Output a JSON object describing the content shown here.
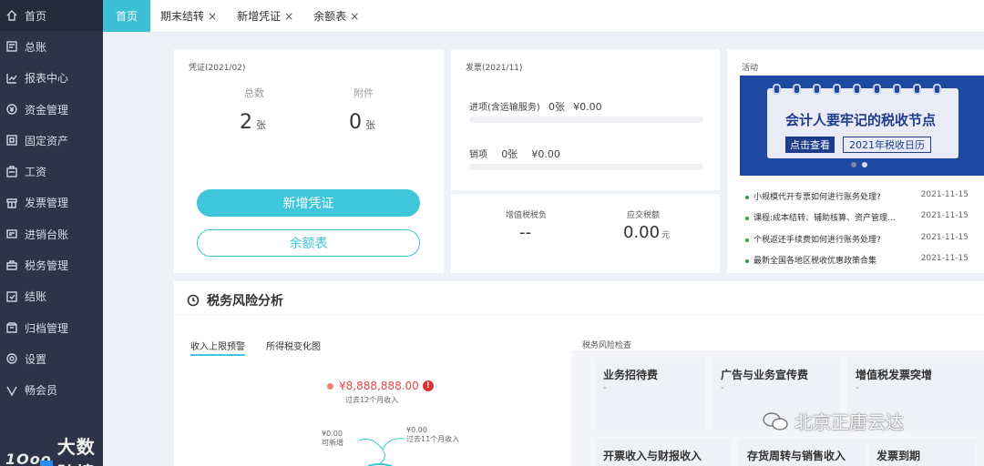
{
  "sidebar": {
    "items": [
      {
        "label": "首页",
        "icon": "home-icon"
      },
      {
        "label": "总账",
        "icon": "ledger-icon"
      },
      {
        "label": "报表中心",
        "icon": "chart-icon"
      },
      {
        "label": "资金管理",
        "icon": "money-icon"
      },
      {
        "label": "固定资产",
        "icon": "asset-icon"
      },
      {
        "label": "工资",
        "icon": "salary-icon"
      },
      {
        "label": "发票管理",
        "icon": "invoice-icon"
      },
      {
        "label": "进销台账",
        "icon": "inventory-icon"
      },
      {
        "label": "税务管理",
        "icon": "tax-icon"
      },
      {
        "label": "结账",
        "icon": "closing-icon"
      },
      {
        "label": "归档管理",
        "icon": "archive-icon"
      },
      {
        "label": "设置",
        "icon": "gear-icon"
      },
      {
        "label": "畅会员",
        "icon": "vip-icon"
      }
    ],
    "logo_text": "大数跨境",
    "logo_mark": "1Ooo"
  },
  "tabs": [
    {
      "label": "首页",
      "closable": false
    },
    {
      "label": "期末结转",
      "closable": true
    },
    {
      "label": "新增凭证",
      "closable": true
    },
    {
      "label": "余额表",
      "closable": true
    }
  ],
  "close_glyph": "×",
  "voucher": {
    "title": "凭证(2021/02)",
    "total_label": "总数",
    "total_value": "2",
    "attach_label": "附件",
    "attach_value": "0",
    "unit": "张",
    "new_button": "新增凭证",
    "balance_button": "余额表"
  },
  "invoice": {
    "title": "发票(2021/11)",
    "input_label": "进项(含运输服务)",
    "input_count": "0张",
    "input_amount": "¥0.00",
    "output_label": "销项",
    "output_count": "0张",
    "output_amount": "¥0.00"
  },
  "tax": {
    "burden_label": "增值税税负",
    "burden_value": "--",
    "payable_label": "应交税额",
    "payable_value": "0.00",
    "payable_unit": "元"
  },
  "activity": {
    "title": "活动",
    "banner_title": "会计人要牢记的税收节点",
    "banner_btn1": "点击查看",
    "banner_btn2": "2021年税收日历",
    "news": [
      {
        "text": "小规模代开专票如何进行账务处理?",
        "date": "2021-11-15"
      },
      {
        "text": "课程:成本结转、辅助核算、资产管理...",
        "date": "2021-11-15"
      },
      {
        "text": "个税返还手续费如何进行账务处理?",
        "date": "2021-11-15"
      },
      {
        "text": "最新全国各地区税收优惠政策合集",
        "date": "2021-11-15"
      }
    ]
  },
  "risk": {
    "title": "税务风险分析",
    "subtabs": [
      "收入上限预警",
      "所得税变化图"
    ],
    "limit_value": "¥8,888,888.00",
    "limit_warn": "!",
    "limit_note": "过去12个月收入",
    "left_note_amount": "¥0.00",
    "left_note_label": "可新增",
    "right_note_amount": "¥0.00",
    "right_note_label": "过去11个月收入",
    "check_title": "税务风险检查",
    "checks": [
      {
        "title": "业务招待费",
        "value": "-"
      },
      {
        "title": "广告与业务宣传费",
        "value": "-"
      },
      {
        "title": "增值税发票突增",
        "value": "-"
      },
      {
        "title": "开票收入与财报收入",
        "value": ""
      },
      {
        "title": "存货周转与销售收入",
        "value": ""
      },
      {
        "title": "发票到期",
        "value": ""
      }
    ]
  },
  "watermark": "北京正唐云达",
  "colors": {
    "accent": "#3fc6db",
    "sidebar": "#2e3448",
    "banner": "#1d4aa0",
    "warn": "#e03131"
  }
}
